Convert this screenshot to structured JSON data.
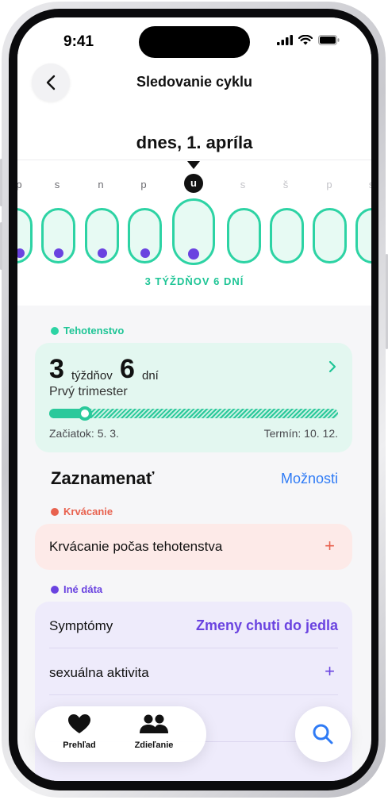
{
  "status_bar": {
    "time": "9:41"
  },
  "nav": {
    "title": "Sledovanie cyklu"
  },
  "header": {
    "date": "dnes, 1. apríla"
  },
  "calendar": {
    "days": [
      "p",
      "s",
      "n",
      "p",
      "u",
      "s",
      "š",
      "p",
      "s"
    ],
    "weeks_label": "3 TÝŽDŇOV 6 DNÍ"
  },
  "pregnancy": {
    "section_label": "Tehotenstvo",
    "weeks_number": "3",
    "weeks_unit": "týždňov",
    "days_number": "6",
    "days_unit": "dní",
    "trimester": "Prvý trimester",
    "progress": 0.1,
    "start": "Začiatok: 5. 3.",
    "due": "Termín: 10. 12."
  },
  "log": {
    "title": "Zaznamenať",
    "options_label": "Možnosti"
  },
  "bleeding": {
    "section_label": "Krvácanie",
    "item_label": "Krvácanie počas tehotenstva",
    "plus": "+"
  },
  "other_data": {
    "section_label": "Iné dáta",
    "rows": [
      {
        "label": "Symptómy",
        "value": "Zmeny chuti do jedla"
      },
      {
        "label": "sexuálna aktivita",
        "value": "+"
      }
    ]
  },
  "tabs": [
    {
      "label": "Prehľad",
      "icon": "heart-icon"
    },
    {
      "label": "Zdieľanie",
      "icon": "people-icon"
    }
  ],
  "colors": {
    "accent_green": "#2dd3a4",
    "accent_blue": "#2f7bf5",
    "accent_red": "#e8624f",
    "accent_purple": "#6a43e0"
  }
}
